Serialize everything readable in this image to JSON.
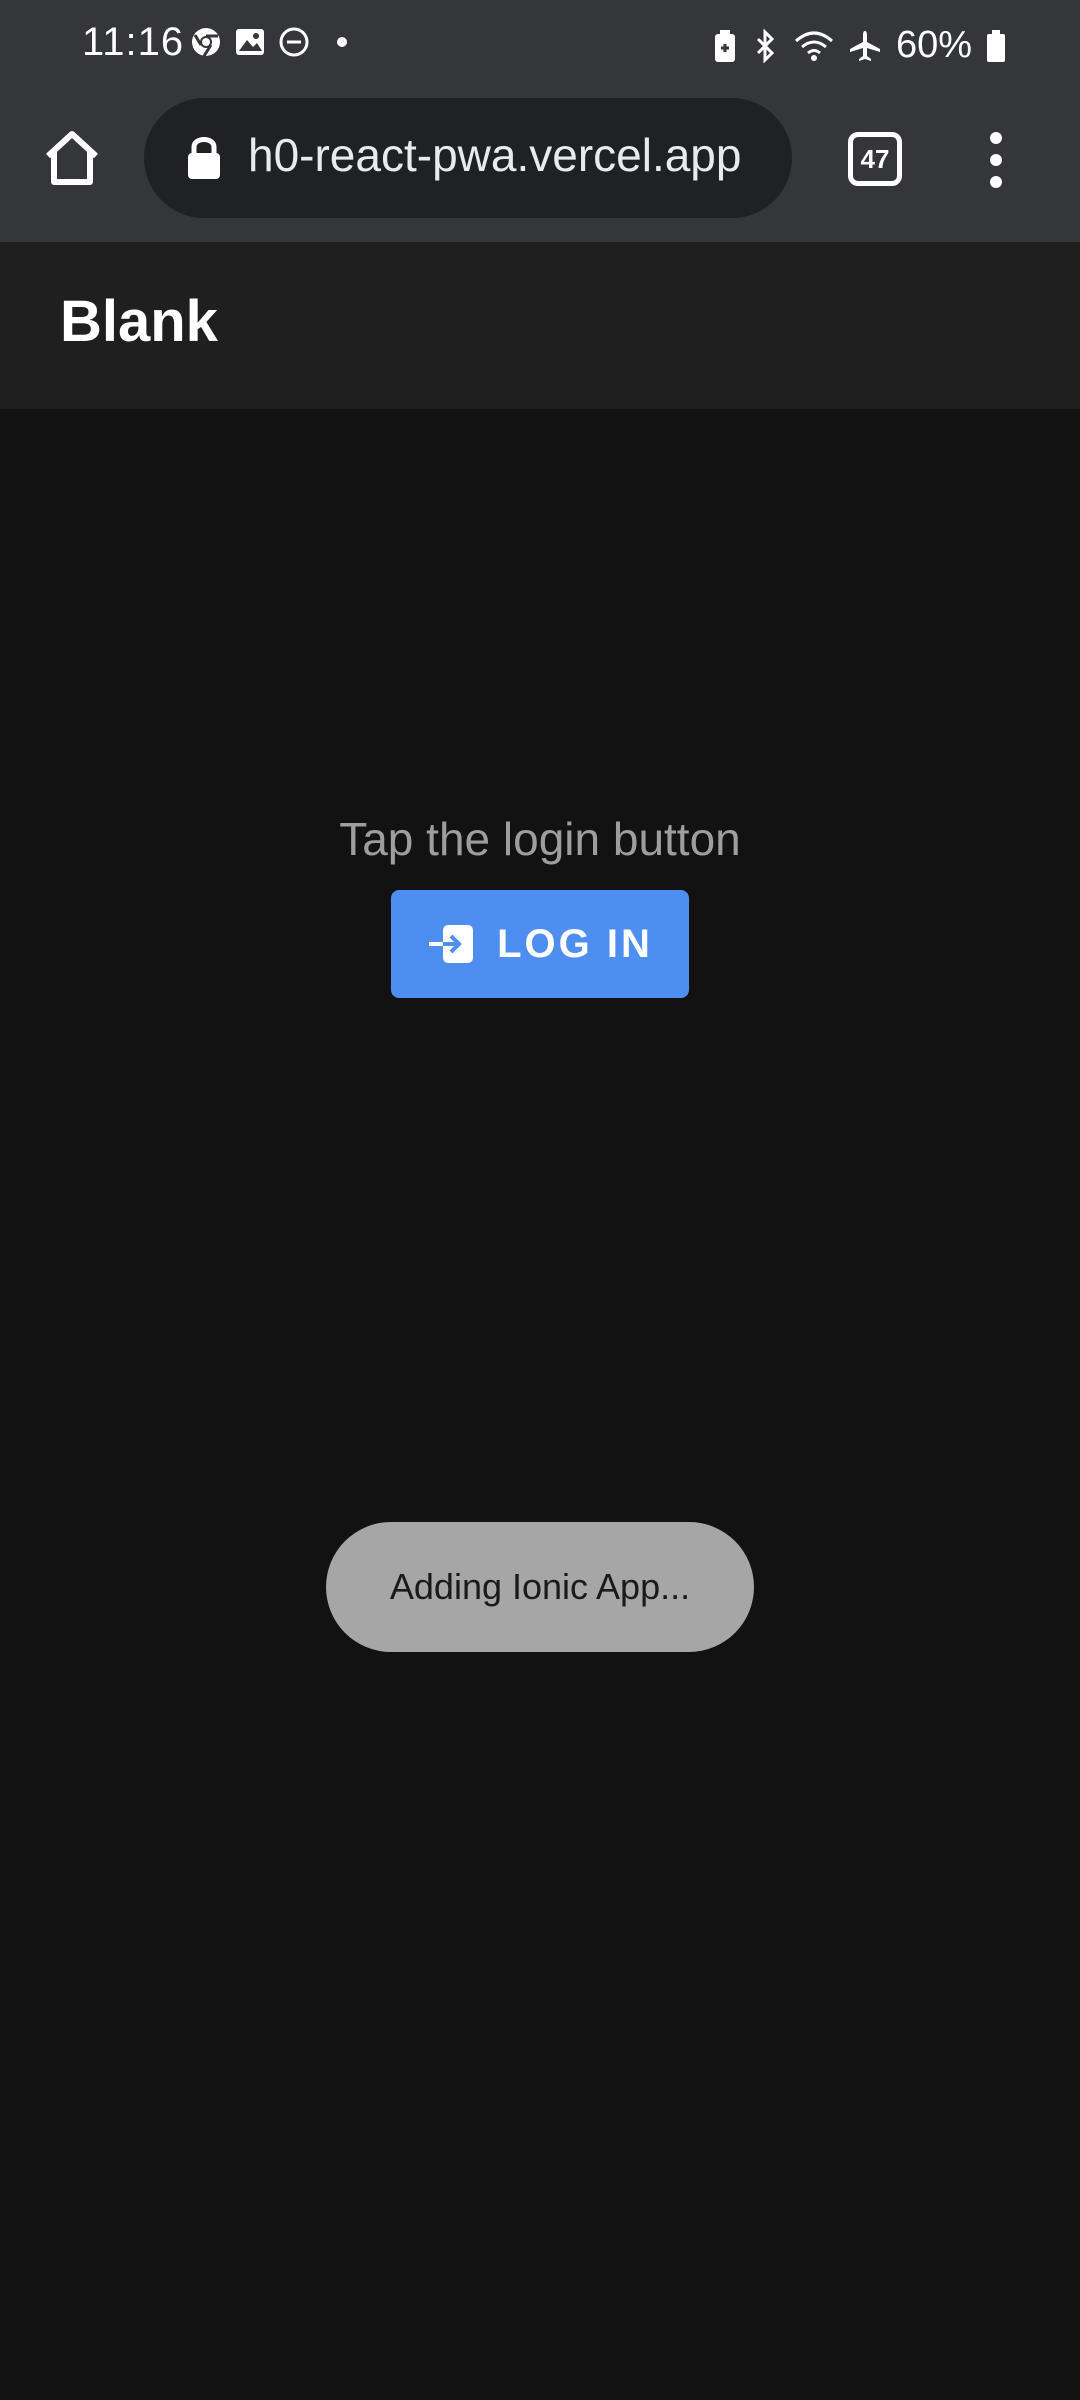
{
  "status_bar": {
    "time": "11:16",
    "battery": "60%",
    "left_icons": [
      "chrome-icon",
      "gallery-icon",
      "do-not-disturb-icon",
      "dot-icon"
    ],
    "right_icons": [
      "battery-saver-icon",
      "bluetooth-icon",
      "wifi-icon",
      "airplane-icon",
      "battery-icon"
    ]
  },
  "browser": {
    "url": "h0-react-pwa.vercel.app",
    "tab_count": "47"
  },
  "app": {
    "title": "Blank",
    "prompt": "Tap the login button",
    "login_label": "LOG IN",
    "toast": "Adding Ionic App..."
  },
  "colors": {
    "accent": "#4d8ef0",
    "background": "#121212",
    "header": "#1f1f1f",
    "toolbar": "#35363a"
  }
}
